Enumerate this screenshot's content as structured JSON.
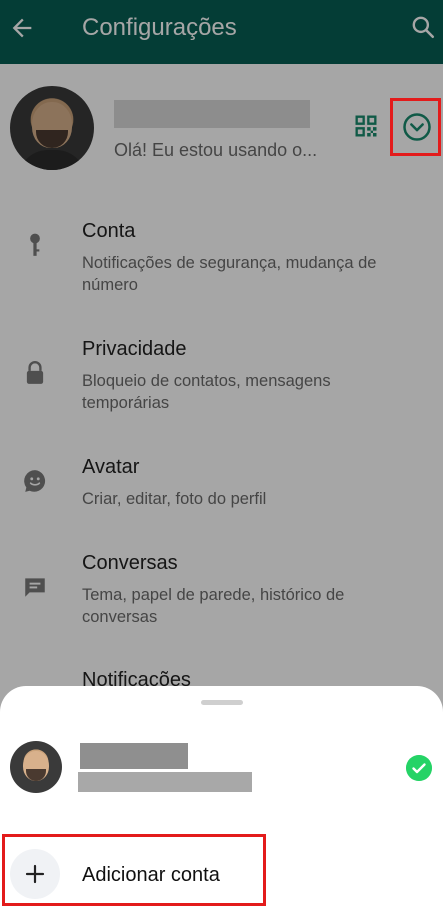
{
  "appbar": {
    "title": "Configurações",
    "back_icon": "arrow-left-icon",
    "search_icon": "search-icon"
  },
  "profile": {
    "status": "Olá! Eu estou usando o...",
    "qr_icon": "qr-code-icon",
    "expand_icon": "chevron-down-circle-icon"
  },
  "settings": {
    "items": [
      {
        "title": "Conta",
        "subtitle": "Notificações de segurança, mudança de número",
        "icon": "key-icon"
      },
      {
        "title": "Privacidade",
        "subtitle": "Bloqueio de contatos, mensagens temporárias",
        "icon": "lock-icon"
      },
      {
        "title": "Avatar",
        "subtitle": "Criar, editar, foto do perfil",
        "icon": "avatar-icon"
      },
      {
        "title": "Conversas",
        "subtitle": "Tema, papel de parede, histórico de conversas",
        "icon": "chat-icon"
      },
      {
        "title": "Notificações",
        "subtitle": "",
        "icon": "bell-icon"
      }
    ]
  },
  "sheet": {
    "add_account_label": "Adicionar conta",
    "add_icon": "plus-icon",
    "check_icon": "check-icon"
  },
  "colors": {
    "appbar": "#075e54",
    "accent": "#25d366",
    "highlight": "#e31b1b"
  }
}
